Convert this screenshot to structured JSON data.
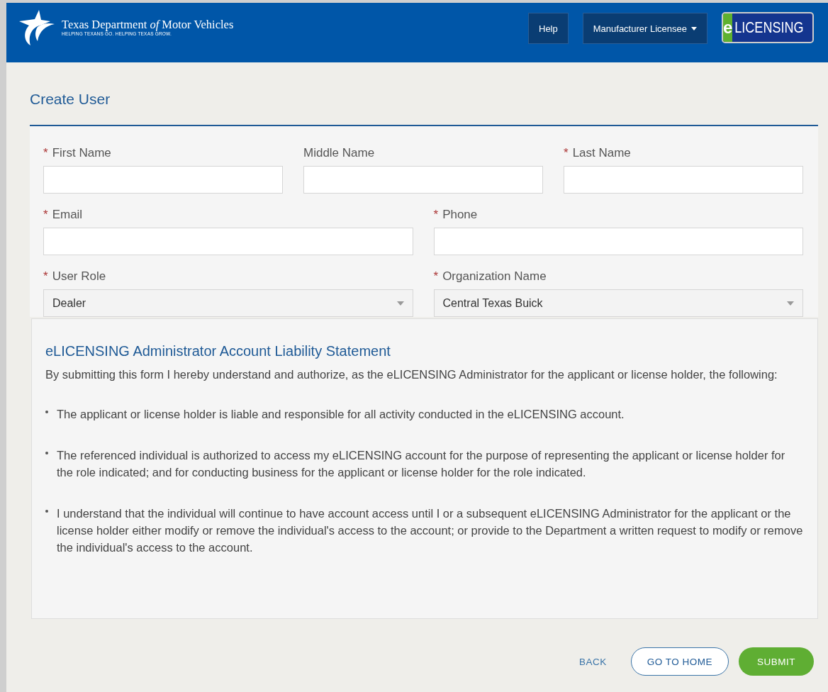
{
  "header": {
    "agency_name": "Texas Department *of* Motor Vehicles",
    "tagline": "HELPING TEXANS GO. HELPING TEXAS GROW.",
    "nav": [
      {
        "label": "Help",
        "kind": "button"
      },
      {
        "label": "Manufacturer Licensee",
        "kind": "dropdown"
      }
    ],
    "badge": {
      "letter": "e",
      "word": "LICENSING"
    }
  },
  "page_title": "Create User",
  "form": {
    "rows": [
      [
        {
          "marker": "*",
          "label": "First Name",
          "kind": "text"
        },
        {
          "label": "Middle Name",
          "kind": "text"
        },
        {
          "marker": "*",
          "label": "Last Name",
          "kind": "text"
        }
      ],
      [
        {
          "marker": "*",
          "label": "Email",
          "kind": "text"
        },
        {
          "marker": "*",
          "label": "Phone",
          "kind": "text"
        }
      ],
      [
        {
          "marker": "*",
          "label": "User Role",
          "kind": "select",
          "value": "Dealer"
        },
        {
          "marker": "*",
          "label": "Organization Name",
          "kind": "select",
          "value": "Central Texas Buick"
        }
      ]
    ]
  },
  "statement": {
    "title": "eLICENSING Administrator Account Liability Statement",
    "intro": "By submitting this form I hereby understand and authorize, as the eLICENSING Administrator for the applicant or license holder, the following:",
    "bullets": [
      "The applicant or license holder is liable and responsible for all activity conducted in the eLICENSING account.",
      "The referenced individual is authorized to access my eLICENSING account for the purpose of representing the applicant or license holder for the role indicated; and for conducting business for the applicant or license holder for the role indicated.",
      "I understand that the individual will continue to have account access until I or a subsequent eLICENSING Administrator for the applicant or the license holder either modify or remove the individual's access to the account; or provide to the Department a written request to modify or remove the individual's access to the account."
    ]
  },
  "buttons": [
    {
      "label": "BACK",
      "kind": "link"
    },
    {
      "label": "GO TO HOME",
      "kind": "outline"
    },
    {
      "label": "SUBMIT",
      "kind": "primary"
    }
  ]
}
